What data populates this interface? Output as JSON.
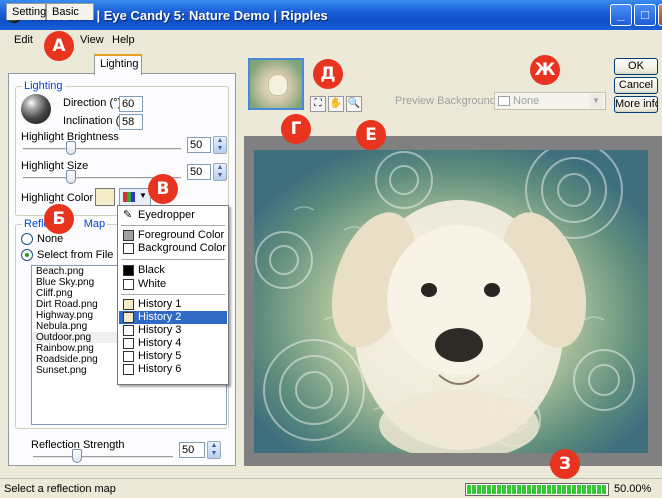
{
  "window": {
    "title": "Alien Skin | Eye Candy 5: Nature Demo | Ripples",
    "minimize_glyph": "_",
    "maximize_glyph": "□",
    "close_glyph": "X"
  },
  "menu": {
    "items": [
      "Edit",
      "View",
      "Help"
    ]
  },
  "tabs": [
    "Settings",
    "Basic",
    "Lighting"
  ],
  "lighting": {
    "legend": "Lighting",
    "direction_label": "Direction (°)",
    "direction_value": "60",
    "inclination_label": "Inclination (°)",
    "inclination_value": "58",
    "highlight_brightness_label": "Highlight Brightness",
    "highlight_brightness_value": "50",
    "highlight_brightness_level": 50,
    "highlight_size_label": "Highlight Size",
    "highlight_size_value": "50",
    "highlight_size_level": 50,
    "highlight_color_label": "Highlight Color",
    "highlight_color": "#f3ecc6"
  },
  "reflection_map": {
    "legend": "Reflection Map",
    "legend_visible_start": "Refle",
    "legend_visible_end": "Map",
    "option_none": "None",
    "option_file": "Select from File",
    "files": [
      "Beach.png",
      "Blue Sky.png",
      "Cliff.png",
      "Dirt Road.png",
      "Highway.png",
      "Nebula.png",
      "Outdoor.png",
      "Rainbow.png",
      "Roadside.png",
      "Sunset.png"
    ],
    "selected_file": "Outdoor.png",
    "strength_label": "Reflection Strength",
    "strength_value": "50",
    "strength_level": 50
  },
  "color_menu": {
    "eyedropper": "Eyedropper",
    "foreground": "Foreground Color",
    "background": "Background Color",
    "black": "Black",
    "white": "White",
    "history": [
      "History 1",
      "History 2",
      "History 3",
      "History 4",
      "History 5",
      "History 6"
    ],
    "selected_history": "History 2"
  },
  "preview": {
    "background_label": "Preview Background:",
    "background_value": "None"
  },
  "buttons": {
    "ok": "OK",
    "cancel": "Cancel",
    "more_info": "More info..."
  },
  "status": {
    "text": "Select a reflection map",
    "zoom": "50.00%",
    "progress_percent": 100
  },
  "annotations": [
    "А",
    "Б",
    "В",
    "Г",
    "Д",
    "Е",
    "Ж",
    "З"
  ],
  "colors": {
    "title_blue": "#1a5fd8",
    "badge_red": "#e8331e",
    "selection_blue": "#316ac5",
    "progress_green": "#37c837"
  }
}
